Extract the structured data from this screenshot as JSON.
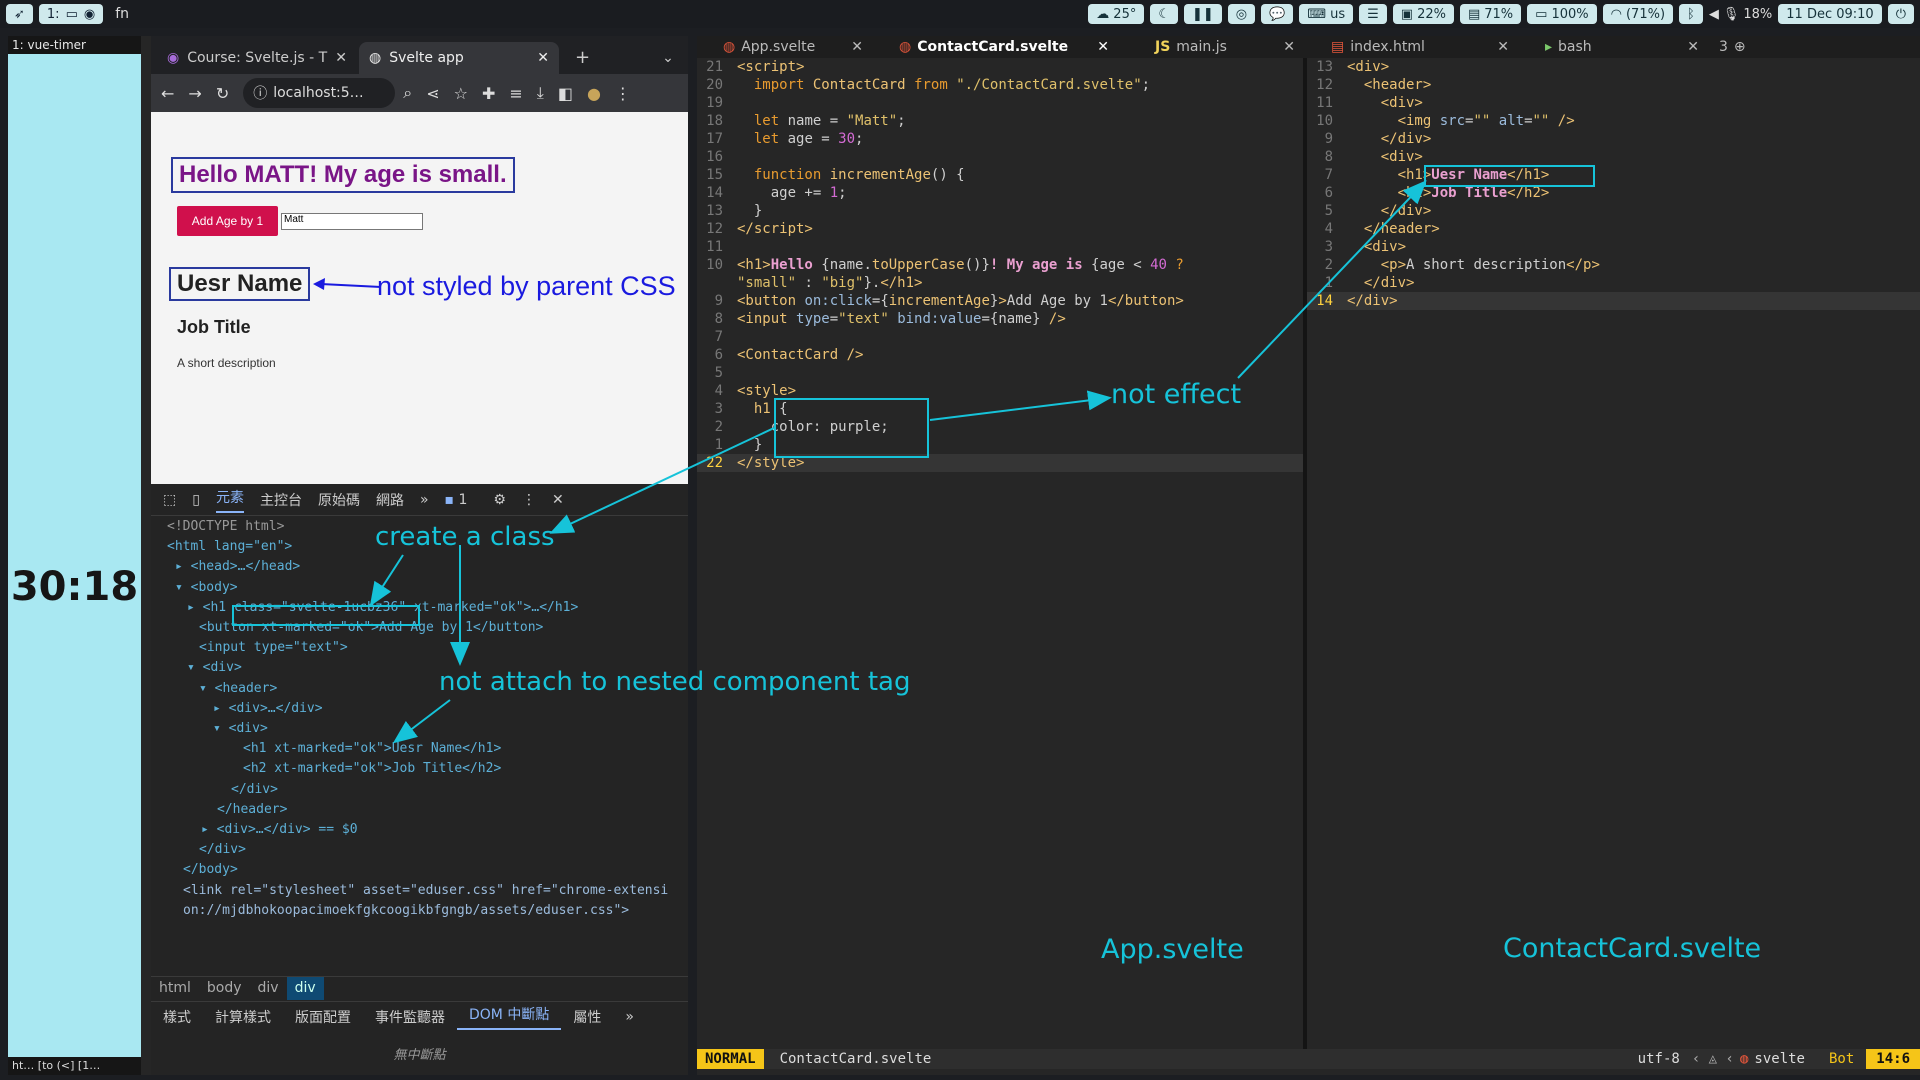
{
  "topbar": {
    "workspace": "1:",
    "fn": "fn",
    "temp": "25°",
    "cpu": "22%",
    "mem": "71%",
    "battery": "100%",
    "wifi": "(71%)",
    "volume": "18%",
    "datetime": "11 Dec 09:10",
    "kb": "us"
  },
  "timer": {
    "title": "1: vue-timer",
    "time": "30:18",
    "footer": "ht… [to (<] [1…"
  },
  "browser": {
    "tabs": [
      {
        "label": "Course: Svelte.js - T"
      },
      {
        "label": "Svelte app"
      }
    ],
    "url": "localhost:5…",
    "page": {
      "heading": "Hello MATT! My age is small.",
      "button": "Add Age by 1",
      "input_value": "Matt",
      "h1": "Uesr Name",
      "h2": "Job Title",
      "desc": "A short description"
    }
  },
  "devtools": {
    "tabs": [
      "元素",
      "主控台",
      "原始碼",
      "網路"
    ],
    "issues": "1",
    "dom": [
      "<!DOCTYPE html>",
      "<html lang=\"en\">",
      "<head>…</head>",
      "<body>",
      "<h1 class=\"svelte-1ucbz36\" xt-marked=\"ok\">…</h1>",
      "<button xt-marked=\"ok\">Add Age by 1</button>",
      "<input type=\"text\">",
      "<div>",
      "<header>",
      "<div>…</div>",
      "<div>",
      "<h1 xt-marked=\"ok\">Uesr Name</h1>",
      "<h2 xt-marked=\"ok\">Job Title</h2>",
      "</div>",
      "</header>",
      "<div>…</div> == $0",
      "</div>",
      "</body>",
      "<link rel=\"stylesheet\" asset=\"eduser.css\" href=\"chrome-extension://mjdbhokoopacimoekfgkcoogikbfgngb/assets/eduser.css\">"
    ],
    "crumbs": [
      "html",
      "body",
      "div",
      "div"
    ],
    "bottom_tabs": [
      "樣式",
      "計算樣式",
      "版面配置",
      "事件監聽器",
      "DOM 中斷點",
      "屬性"
    ],
    "no_breakpoints": "無中斷點"
  },
  "annotations": {
    "not_styled": "not styled by parent CSS",
    "create_class": "create a class",
    "not_attach": "not attach to nested component tag",
    "not_effect": "not effect",
    "app_label": "App.svelte",
    "contact_label": "ContactCard.svelte"
  },
  "editor": {
    "tabs": [
      "App.svelte",
      "ContactCard.svelte",
      "main.js",
      "index.html",
      "bash"
    ],
    "tab_count": "3",
    "status": {
      "mode": "NORMAL",
      "file": "ContactCard.svelte",
      "enc": "utf-8",
      "ft": "svelte",
      "scroll": "Bot",
      "pos": "14:6"
    }
  }
}
